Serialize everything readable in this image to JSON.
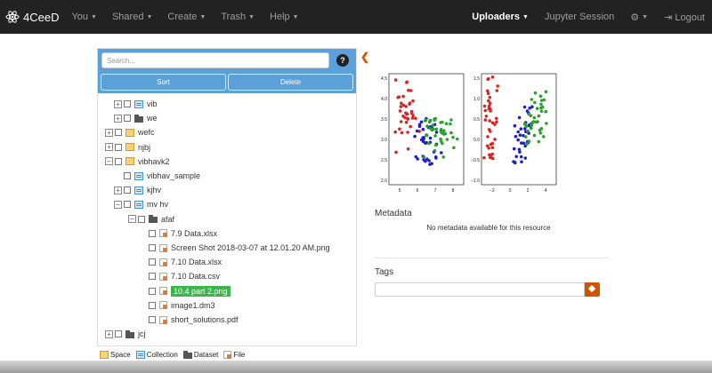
{
  "navbar": {
    "brand": "4CeeD",
    "left": [
      "You",
      "Shared",
      "Create",
      "Trash",
      "Help"
    ],
    "uploaders": "Uploaders",
    "jupyter": "Jupyter Session",
    "logout": "Logout"
  },
  "panel": {
    "search_placeholder": "Search...",
    "help": "?",
    "sort": "Sort",
    "delete": "Delete"
  },
  "tree": [
    {
      "label": "vib",
      "icon": "collection-icon",
      "toggle": "⊞",
      "indent": 1
    },
    {
      "label": "we",
      "icon": "dataset-icon",
      "toggle": "⊞",
      "indent": 1
    },
    {
      "label": "wefc",
      "icon": "space-icon",
      "toggle": "⊞",
      "indent": 0
    },
    {
      "label": "njbj",
      "icon": "space-icon",
      "toggle": "⊞",
      "indent": 0
    },
    {
      "label": "vibhavk2",
      "icon": "space-icon",
      "toggle": "⊟",
      "indent": 0
    },
    {
      "label": "vibhav_sample",
      "icon": "collection-icon",
      "toggle": "",
      "indent": 1
    },
    {
      "label": "kjhv",
      "icon": "collection-icon",
      "toggle": "⊞",
      "indent": 1
    },
    {
      "label": "mv hv",
      "icon": "collection-icon",
      "toggle": "⊟",
      "indent": 1
    },
    {
      "label": "afaf",
      "icon": "dataset-icon",
      "toggle": "⊟",
      "indent": 2
    },
    {
      "label": "7.9 Data.xlsx",
      "icon": "file-icon",
      "toggle": "",
      "indent": 3
    },
    {
      "label": "Screen Shot 2018-03-07 at 12.01.20 AM.png",
      "icon": "file-icon",
      "toggle": "",
      "indent": 3
    },
    {
      "label": "7.10 Data.xlsx",
      "icon": "file-icon",
      "toggle": "",
      "indent": 3
    },
    {
      "label": "7.10 Data.csv",
      "icon": "file-icon",
      "toggle": "",
      "indent": 3
    },
    {
      "label": "10.4 part 2.png",
      "icon": "file-icon",
      "toggle": "",
      "indent": 3,
      "selected": true
    },
    {
      "label": "image1.dm3",
      "icon": "file-icon",
      "toggle": "",
      "indent": 3
    },
    {
      "label": "short_solutions.pdf",
      "icon": "file-icon",
      "toggle": "",
      "indent": 3
    },
    {
      "label": "jcj",
      "icon": "dataset-icon",
      "toggle": "⊞",
      "indent": 0
    }
  ],
  "legend": {
    "space": "Space",
    "collection": "Collection",
    "dataset": "Dataset",
    "file": "File"
  },
  "metadata": {
    "title": "Metadata",
    "message": "No metadata available for this resource"
  },
  "tags": {
    "title": "Tags"
  },
  "plots": {
    "left": {
      "xticks": [
        "5",
        "6",
        "7",
        "8"
      ],
      "yticks": [
        "4.5",
        "4.0",
        "3.5",
        "3.0",
        "2.5",
        "2.0"
      ]
    },
    "right": {
      "xticks": [
        "−2",
        "0",
        "2",
        "4"
      ],
      "yticks": [
        "1.5",
        "1.0",
        "0.5",
        "0.0",
        "−0.5",
        "−1.0"
      ]
    },
    "colors": {
      "red": "#d62728",
      "blue": "#1f1fcc",
      "green": "#2ca02c"
    }
  }
}
